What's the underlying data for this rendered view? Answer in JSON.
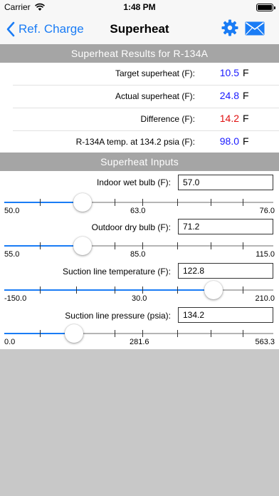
{
  "status_bar": {
    "carrier": "Carrier",
    "time": "1:48 PM"
  },
  "nav": {
    "back_label": "Ref. Charge",
    "title": "Superheat"
  },
  "results": {
    "header": "Superheat Results for R-134A",
    "rows": [
      {
        "label": "Target superheat (F):",
        "value": "10.5",
        "unit": "F",
        "color": "#1a1aff"
      },
      {
        "label": "Actual superheat (F):",
        "value": "24.8",
        "unit": "F",
        "color": "#1a1aff"
      },
      {
        "label": "Difference (F):",
        "value": "14.2",
        "unit": "F",
        "color": "#e01010"
      },
      {
        "label": "R-134A temp. at 134.2 psia (F):",
        "value": "98.0",
        "unit": "F",
        "color": "#1a1aff"
      }
    ]
  },
  "inputs": {
    "header": "Superheat Inputs",
    "fields": [
      {
        "label": "Indoor wet bulb (F):",
        "value": "57.0",
        "min": "50.0",
        "mid": "63.0",
        "max": "76.0",
        "min_val": 50,
        "max_val": 76,
        "current": 57
      },
      {
        "label": "Outdoor dry bulb (F):",
        "value": "71.2",
        "min": "55.0",
        "mid": "85.0",
        "max": "115.0",
        "min_val": 55,
        "max_val": 115,
        "current": 71.2
      },
      {
        "label": "Suction line temperature (F):",
        "value": "122.8",
        "min": "-150.0",
        "mid": "30.0",
        "max": "210.0",
        "min_val": -150,
        "max_val": 210,
        "current": 122.8
      },
      {
        "label": "Suction line pressure (psia):",
        "value": "134.2",
        "min": "0.0",
        "mid": "281.6",
        "max": "563.3",
        "min_val": 0,
        "max_val": 563.3,
        "current": 134.2
      }
    ]
  },
  "colors": {
    "accent": "#1a7cf5",
    "header_bg": "#a5a5a5",
    "empty_bg": "#c8c8c8"
  },
  "icons": {
    "back": "chevron-left-icon",
    "settings": "gear-icon",
    "mail": "mail-icon",
    "wifi": "wifi-icon",
    "battery": "battery-icon"
  }
}
